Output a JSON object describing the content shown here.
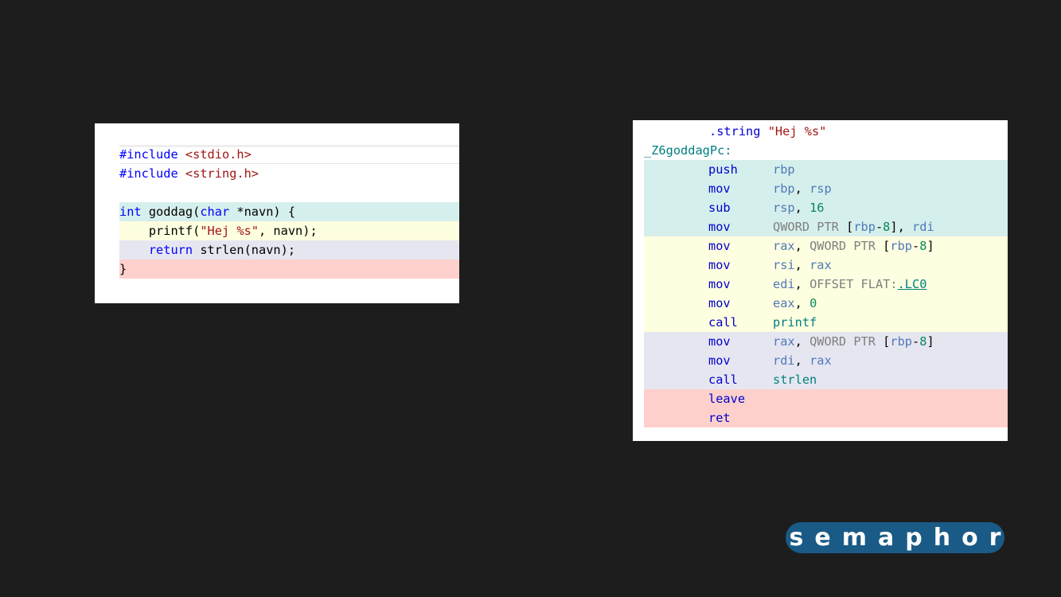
{
  "c_code": {
    "line1": {
      "directive": "#include",
      "header": "<stdio.h>"
    },
    "line2": {
      "directive": "#include",
      "header": "<string.h>"
    },
    "line4": {
      "kw_int": "int",
      "fn": " goddag(",
      "kw_char": "char",
      "rest": " *navn) {"
    },
    "line5": {
      "indent": "    printf(",
      "str": "\"Hej %s\"",
      "rest": ", navn);"
    },
    "line6": {
      "indent": "    ",
      "kw_return": "return",
      "rest": " strlen(navn);"
    },
    "line7": {
      "brace": "}"
    }
  },
  "asm_code": {
    "l0": {
      "directive": ".string",
      "str": "\"Hej %s\""
    },
    "l1": {
      "label": "_Z6goddagPc:"
    },
    "l2": {
      "op": "push",
      "a1": "rbp"
    },
    "l3": {
      "op": "mov",
      "a1": "rbp",
      "sep": ", ",
      "a2": "rsp"
    },
    "l4": {
      "op": "sub",
      "a1": "rsp",
      "sep": ", ",
      "num": "16"
    },
    "l5": {
      "op": "mov",
      "ptr": "QWORD PTR",
      "lb": " [",
      "reg": "rbp",
      "minus": "-",
      "off": "8",
      "rb": "], ",
      "a2": "rdi"
    },
    "l6": {
      "op": "mov",
      "a1": "rax",
      "sep": ", ",
      "ptr": "QWORD PTR",
      "lb": " [",
      "reg": "rbp",
      "minus": "-",
      "off": "8",
      "rb": "]"
    },
    "l7": {
      "op": "mov",
      "a1": "rsi",
      "sep": ", ",
      "a2": "rax"
    },
    "l8": {
      "op": "mov",
      "a1": "edi",
      "sep": ", ",
      "flat": "OFFSET FLAT:",
      "link": ".LC0"
    },
    "l9": {
      "op": "mov",
      "a1": "eax",
      "sep": ", ",
      "num": "0"
    },
    "l10": {
      "op": "call",
      "fn": "printf"
    },
    "l11": {
      "op": "mov",
      "a1": "rax",
      "sep": ", ",
      "ptr": "QWORD PTR",
      "lb": " [",
      "reg": "rbp",
      "minus": "-",
      "off": "8",
      "rb": "]"
    },
    "l12": {
      "op": "mov",
      "a1": "rdi",
      "sep": ", ",
      "a2": "rax"
    },
    "l13": {
      "op": "call",
      "fn": "strlen"
    },
    "l14": {
      "op": "leave"
    },
    "l15": {
      "op": "ret"
    }
  },
  "highlight_colors": {
    "teal": "#d5efec",
    "yellow": "#fefee0",
    "lavender": "#e6e6f1",
    "pink": "#fed0cb"
  },
  "logo": {
    "text": "semaphor"
  }
}
